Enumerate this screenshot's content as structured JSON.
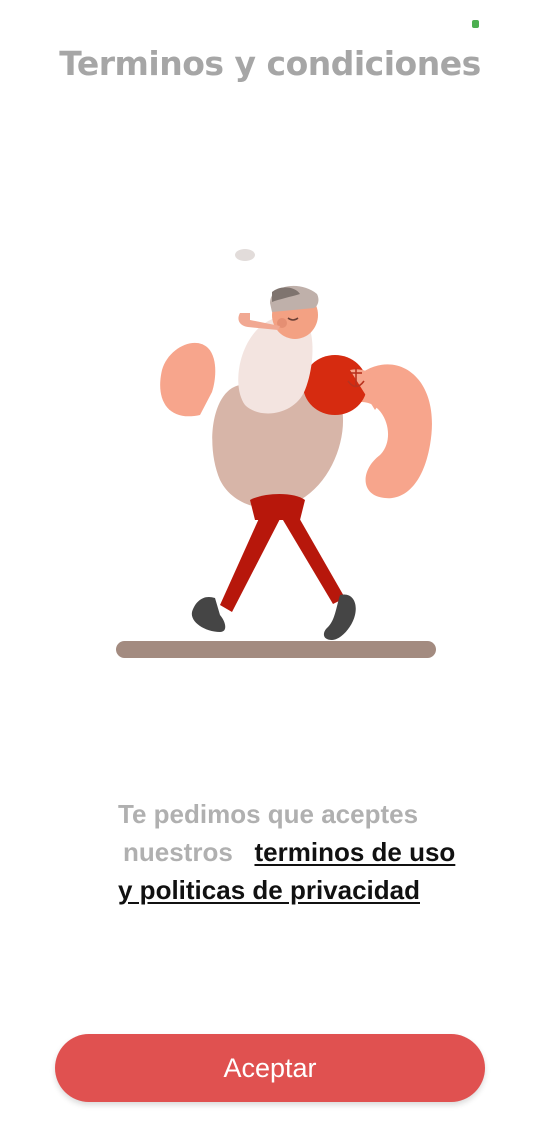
{
  "page": {
    "title": "Terminos y condiciones"
  },
  "illustration": {
    "icon": "walking-sailor-illustration"
  },
  "message": {
    "line1": "Te pedimos que aceptes",
    "line2_prefix": "nuestros",
    "link_part1": "terminos de uso",
    "link_part2": "y politicas de privacidad"
  },
  "actions": {
    "accept_label": "Aceptar"
  },
  "colors": {
    "accent": "#e05150",
    "title_gray": "#a6a6a6",
    "body_gray": "#b0b0b0",
    "link": "#111111",
    "status_dot": "#4caf50"
  }
}
